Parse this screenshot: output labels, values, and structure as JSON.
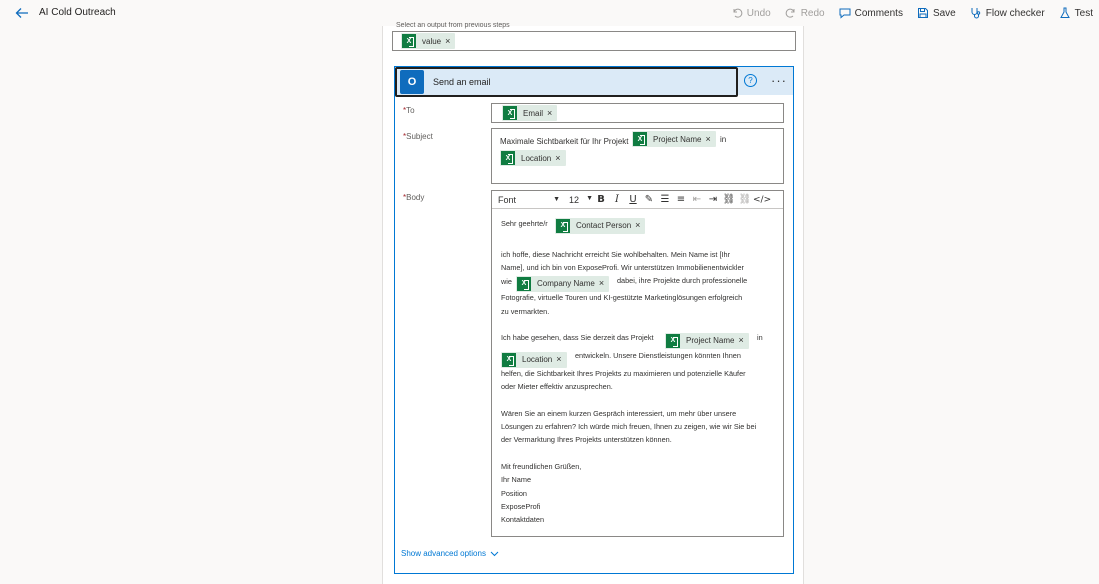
{
  "app": {
    "title": "AI Cold Outreach"
  },
  "toolbar": {
    "undo": "Undo",
    "redo": "Redo",
    "comments": "Comments",
    "save": "Save",
    "flow_checker": "Flow checker",
    "test": "Test"
  },
  "previous": {
    "label": "Select an output from previous steps",
    "token": "value"
  },
  "action": {
    "title": "Send an email",
    "icon": "outlook-icon",
    "more": "···"
  },
  "fields": {
    "to_label": "To",
    "to_token": "Email",
    "subject_label": "Subject",
    "subject_text": "Maximale Sichtbarkeit für Ihr Projekt",
    "subject_token1": "Project Name",
    "subject_in": "in",
    "subject_token2": "Location",
    "body_label": "Body",
    "required_mark": "*"
  },
  "editor": {
    "font": "Font",
    "size": "12"
  },
  "body": {
    "greeting": "Sehr geehrte/r",
    "greeting_token": "Contact Person",
    "p1_l1": "ich hoffe, diese Nachricht erreicht Sie wohlbehalten. Mein Name ist [Ihr",
    "p1_l2": "Name], und ich bin von ExposeProfi. Wir unterstützen Immobilienentwickler",
    "p1_wie": "wie",
    "p1_token": "Company Name",
    "p1_l3": "dabei, ihre Projekte durch professionelle",
    "p1_l4": "Fotografie, virtuelle Touren und KI-gestützte Marketinglösungen erfolgreich",
    "p1_l5": "zu vermarkten.",
    "p2_l1": "Ich habe gesehen, dass Sie derzeit das Projekt",
    "p2_token1": "Project Name",
    "p2_in": "in",
    "p2_token2": "Location",
    "p2_l2": "entwickeln. Unsere Dienstleistungen könnten Ihnen",
    "p2_l3": "helfen, die Sichtbarkeit Ihres Projekts zu maximieren und potenzielle Käufer",
    "p2_l4": "oder Mieter effektiv anzusprechen.",
    "p3_l1": "Wären Sie an einem kurzen Gespräch interessiert, um mehr über unsere",
    "p3_l2": "Lösungen zu erfahren? Ich würde mich freuen, Ihnen zu zeigen, wie wir Sie bei",
    "p3_l3": "der Vermarktung Ihres Projekts unterstützen können.",
    "sig1": "Mit freundlichen Grüßen,",
    "sig2": "Ihr Name",
    "sig3": "Position",
    "sig4": "ExposeProfi",
    "sig5": "Kontaktdaten"
  },
  "advanced": "Show advanced options"
}
